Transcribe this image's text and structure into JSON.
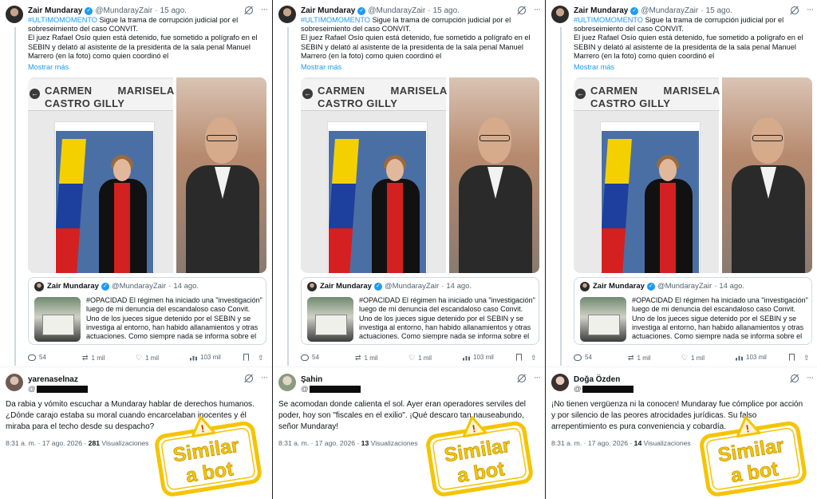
{
  "colors": {
    "link": "#1d9bf0",
    "text": "#0f1419",
    "muted": "#536471",
    "stamp_yellow": "#f5c400",
    "stamp_red": "#d61f1f",
    "divider": "#222222"
  },
  "icons": [
    "verified-badge-icon",
    "grok-icon",
    "more-icon",
    "back-arrow-icon",
    "reply-icon",
    "retweet-icon",
    "like-icon",
    "views-icon",
    "bookmark-icon",
    "share-icon",
    "warning-icon"
  ],
  "panels": [
    {
      "tweet": {
        "name": "Zair Mundaray",
        "verified_glyph": "✓",
        "handle": "@MundarayZair",
        "separator": "·",
        "date": "15 ago.",
        "more_glyph": "···",
        "hashtag": "#ULTIMOMOMENTO",
        "text_1": " Sigue la trama de corrupción judicial por el sobreseimiento del caso CONVIT.",
        "text_2": "El juez Rafael Osío quien está detenido, fue sometido a polígrafo en el SEBIN y delató al asistente de la presidenta de la sala penal Manuel Marrero (en la foto) como quien coordinó el",
        "show_more": "Mostrar más",
        "image_caption": "CARMEN        MARISELA\nCASTRO GILLY",
        "back_glyph": "←",
        "quote": {
          "name": "Zair Mundaray",
          "verified_glyph": "✓",
          "handle": "@MundarayZair",
          "separator": "·",
          "date": "14 ago.",
          "text": "#OPACIDAD El régimen ha iniciado una \"investigación\" luego de mi denuncia del escandaloso caso Convit. Uno de los jueces sigue detenido por el SEBIN y se investiga al entorno, han habido allanamientos y otras actuaciones. Como siempre nada se informa sobre el ..."
        },
        "actions": {
          "replies": "54",
          "retweets": "1 mil",
          "likes": "1 mil",
          "views": "103 mil",
          "retweet_glyph": "⇄",
          "like_glyph": "♡",
          "share_glyph": "⇧"
        }
      },
      "reply": {
        "name": "yarenaselnaz",
        "handle_prefix": "@",
        "text": "Da rabia y vómito escuchar a Mundaray hablar de derechos humanos. ¿Dónde carajo estaba su moral cuando encarcelaban inocentes y él miraba para el techo desde su despacho?",
        "time": "8:31 a. m. · 17 ago. 2026 ·",
        "views_count": "281",
        "views_label": "Visualizaciones"
      },
      "stamp": {
        "line1": "Similar",
        "line2": "a bot",
        "warning_glyph": "!"
      }
    },
    {
      "tweet": {
        "name": "Zair Mundaray",
        "verified_glyph": "✓",
        "handle": "@MundarayZair",
        "separator": "·",
        "date": "15 ago.",
        "more_glyph": "···",
        "hashtag": "#ULTIMOMOMENTO",
        "text_1": " Sigue la trama de corrupción judicial por el sobreseimiento del caso CONVIT.",
        "text_2": "El juez Rafael Osío quien está detenido, fue sometido a polígrafo en el SEBIN y delató al asistente de la presidenta de la sala penal Manuel Marrero (en la foto) como quien coordinó el",
        "show_more": "Mostrar más",
        "image_caption": "CARMEN        MARISELA\nCASTRO GILLY",
        "back_glyph": "←",
        "quote": {
          "name": "Zair Mundaray",
          "verified_glyph": "✓",
          "handle": "@MundarayZair",
          "separator": "·",
          "date": "14 ago.",
          "text": "#OPACIDAD El régimen ha iniciado una \"investigación\" luego de mi denuncia del escandaloso caso Convit. Uno de los jueces sigue detenido por el SEBIN y se investiga al entorno, han habido allanamientos y otras actuaciones. Como siempre nada se informa sobre el ..."
        },
        "actions": {
          "replies": "54",
          "retweets": "1 mil",
          "likes": "1 mil",
          "views": "103 mil",
          "retweet_glyph": "⇄",
          "like_glyph": "♡",
          "share_glyph": "⇧"
        }
      },
      "reply": {
        "name": "Şahin",
        "handle_prefix": "@",
        "text": "Se acomodan donde calienta el sol. Ayer eran operadores serviles del poder, hoy son \"fiscales en el exilio\". ¡Qué descaro tan nauseabundo, señor Mundaray!",
        "time": "8:31 a. m. · 17 ago. 2026 ·",
        "views_count": "13",
        "views_label": "Visualizaciones"
      },
      "stamp": {
        "line1": "Similar",
        "line2": "a bot",
        "warning_glyph": "!"
      }
    },
    {
      "tweet": {
        "name": "Zair Mundaray",
        "verified_glyph": "✓",
        "handle": "@MundarayZair",
        "separator": "·",
        "date": "15 ago.",
        "more_glyph": "···",
        "hashtag": "#ULTIMOMOMENTO",
        "text_1": " Sigue la trama de corrupción judicial por el sobreseimiento del caso CONVIT.",
        "text_2": "El juez Rafael Osío quien está detenido, fue sometido a polígrafo en el SEBIN y delató al asistente de la presidenta de la sala penal Manuel Marrero (en la foto) como quien coordinó el",
        "show_more": "Mostrar más",
        "image_caption": "CARMEN        MARISELA\nCASTRO GILLY",
        "back_glyph": "←",
        "quote": {
          "name": "Zair Mundaray",
          "verified_glyph": "✓",
          "handle": "@MundarayZair",
          "separator": "·",
          "date": "14 ago.",
          "text": "#OPACIDAD El régimen ha iniciado una \"investigación\" luego de mi denuncia del escandaloso caso Convit. Uno de los jueces sigue detenido por el SEBIN y se investiga al entorno, han habido allanamientos y otras actuaciones. Como siempre nada se informa sobre el ..."
        },
        "actions": {
          "replies": "54",
          "retweets": "1 mil",
          "likes": "1 mil",
          "views": "103 mil",
          "retweet_glyph": "⇄",
          "like_glyph": "♡",
          "share_glyph": "⇧"
        }
      },
      "reply": {
        "name": "Doğa Özden",
        "handle_prefix": "@",
        "text": "¡No tienen vergüenza ni la conocen! Mundaray fue cómplice por acción y por silencio de las peores atrocidades jurídicas. Su falso arrepentimiento es pura conveniencia y cobardía.",
        "time": "8:31 a. m. · 17 ago. 2026 ·",
        "views_count": "14",
        "views_label": "Visualizaciones"
      },
      "stamp": {
        "line1": "Similar",
        "line2": "a bot",
        "warning_glyph": "!"
      }
    }
  ]
}
